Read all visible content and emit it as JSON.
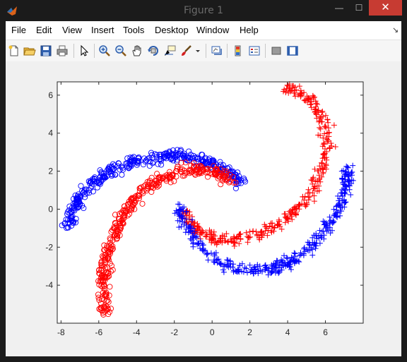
{
  "window": {
    "title": "Figure 1",
    "minimize_glyph": "—",
    "maximize_glyph": "☐",
    "close_glyph": "✕"
  },
  "menu": {
    "items": [
      "File",
      "Edit",
      "View",
      "Insert",
      "Tools",
      "Desktop",
      "Window",
      "Help"
    ],
    "overflow_glyph": "↘"
  },
  "toolbar": {
    "icons": [
      "new-figure-icon",
      "open-file-icon",
      "save-icon",
      "print-icon",
      "pointer-icon",
      "zoom-in-icon",
      "zoom-out-icon",
      "pan-icon",
      "rotate-3d-icon",
      "data-cursor-icon",
      "brush-icon",
      "brush-dropdown-icon",
      "link-plot-icon",
      "colorbar-icon",
      "legend-icon",
      "hide-plot-tools-icon",
      "show-plot-tools-icon"
    ]
  },
  "chart_data": {
    "type": "scatter",
    "title": "",
    "xlabel": "",
    "ylabel": "",
    "xlim": [
      -8.2,
      8
    ],
    "ylim": [
      -6,
      6.7
    ],
    "xticks": [
      -8,
      -6,
      -4,
      -2,
      0,
      2,
      4,
      6
    ],
    "yticks": [
      -4,
      -2,
      0,
      2,
      4,
      6
    ],
    "grid": false,
    "legend": "none",
    "series": [
      {
        "marker": "circle",
        "color": "#0000ff",
        "description_points_along_arm": [
          [
            -7.6,
            -1.0
          ],
          [
            -7.4,
            0.0
          ],
          [
            -6.9,
            0.8
          ],
          [
            -6.2,
            1.5
          ],
          [
            -5.4,
            2.0
          ],
          [
            -4.4,
            2.4
          ],
          [
            -3.3,
            2.7
          ],
          [
            -2.2,
            2.8
          ],
          [
            -1.1,
            2.7
          ],
          [
            0.0,
            2.4
          ],
          [
            0.9,
            1.9
          ],
          [
            1.6,
            1.3
          ]
        ]
      },
      {
        "marker": "circle",
        "color": "#ff0000",
        "description_points_along_arm": [
          [
            -5.6,
            -5.6
          ],
          [
            -5.8,
            -4.5
          ],
          [
            -5.7,
            -3.4
          ],
          [
            -5.5,
            -2.3
          ],
          [
            -5.1,
            -1.2
          ],
          [
            -4.6,
            -0.2
          ],
          [
            -3.9,
            0.7
          ],
          [
            -3.1,
            1.4
          ],
          [
            -2.1,
            1.9
          ],
          [
            -1.0,
            2.1
          ],
          [
            0.1,
            2.0
          ],
          [
            1.0,
            1.6
          ]
        ]
      },
      {
        "marker": "plus",
        "color": "#ff0000",
        "description_points_along_arm": [
          [
            -1.6,
            -0.1
          ],
          [
            -0.8,
            -1.1
          ],
          [
            0.2,
            -1.6
          ],
          [
            1.4,
            -1.6
          ],
          [
            2.6,
            -1.3
          ],
          [
            3.7,
            -0.7
          ],
          [
            4.6,
            0.1
          ],
          [
            5.4,
            1.1
          ],
          [
            5.9,
            2.3
          ],
          [
            6.1,
            3.5
          ],
          [
            5.9,
            4.7
          ],
          [
            5.3,
            5.6
          ],
          [
            4.6,
            6.2
          ],
          [
            3.9,
            6.4
          ]
        ]
      },
      {
        "marker": "plus",
        "color": "#0000ff",
        "description_points_along_arm": [
          [
            -1.7,
            0.2
          ],
          [
            -1.3,
            -1.1
          ],
          [
            -0.5,
            -2.2
          ],
          [
            0.6,
            -2.9
          ],
          [
            1.8,
            -3.2
          ],
          [
            3.0,
            -3.2
          ],
          [
            4.1,
            -2.8
          ],
          [
            5.1,
            -2.1
          ],
          [
            6.0,
            -1.1
          ],
          [
            6.7,
            0.0
          ],
          [
            7.1,
            1.2
          ],
          [
            7.2,
            2.4
          ]
        ]
      }
    ]
  }
}
